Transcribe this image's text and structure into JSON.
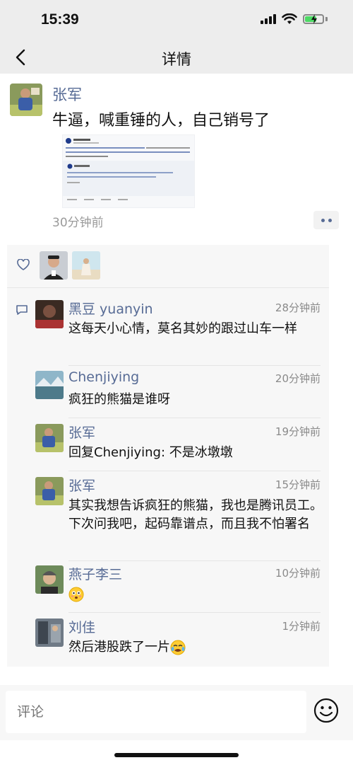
{
  "status_bar": {
    "time": "15:39"
  },
  "nav": {
    "title": "详情"
  },
  "post": {
    "author": "张军",
    "text": "牛逼，喊重锤的人，自己销号了",
    "time": "30分钟前"
  },
  "comments": [
    {
      "name": "黑豆 yuanyin",
      "time": "28分钟前",
      "text": "这每天小心情，莫名其妙的跟过山车一样"
    },
    {
      "name": "Chenjiying",
      "time": "20分钟前",
      "text": "疯狂的熊猫是谁呀"
    },
    {
      "name": "张军",
      "time": "19分钟前",
      "text": "回复Chenjiying: 不是冰墩墩"
    },
    {
      "name": "张军",
      "time": "15分钟前",
      "text": "其实我想告诉疯狂的熊猫，我也是腾讯员工。下次问我吧，起码靠谱点，而且我不怕署名"
    },
    {
      "name": "燕子李三",
      "time": "10分钟前",
      "text": ""
    },
    {
      "name": "刘佳",
      "time": "1分钟前",
      "text": "然后港股跌了一片"
    }
  ],
  "comment_input": {
    "placeholder": "评论"
  },
  "colors": {
    "link": "#576b95",
    "background": "#ededed"
  }
}
